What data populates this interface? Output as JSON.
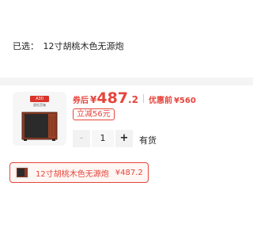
{
  "selection": {
    "label": "已选：",
    "value": "12寸胡桃木色无源炮"
  },
  "product": {
    "badge": "A30",
    "tagline": "超低音箱",
    "price_after_label": "券后",
    "currency": "¥",
    "price_int": "487",
    "price_dec": ".2",
    "price_before_label": "优惠前",
    "price_before": "¥560",
    "discount_tag": "立减56元",
    "colors": {
      "accent": "#e5453c",
      "wood": "#8b3a22",
      "cabinet": "#2b2b2b"
    }
  },
  "quantity": {
    "minus": "-",
    "value": "1",
    "plus": "+"
  },
  "stock_status": "有货",
  "variant_chip": {
    "name": "12寸胡桃木色无源炮",
    "price": "¥487.2"
  }
}
